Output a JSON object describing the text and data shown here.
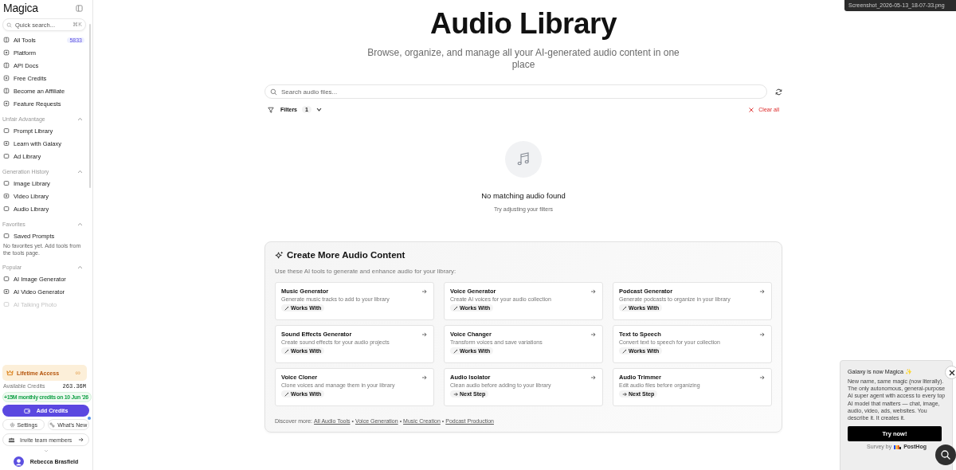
{
  "sidebar": {
    "logo": "Magica",
    "search": {
      "placeholder": "Quick search...",
      "shortcut": "⌘K"
    },
    "main_items": [
      {
        "label": "All Tools",
        "badge": "5833"
      },
      {
        "label": "Platform"
      },
      {
        "label": "API Docs"
      },
      {
        "label": "Free Credits"
      },
      {
        "label": "Become an Affiliate"
      },
      {
        "label": "Feature Requests"
      }
    ],
    "sections": [
      {
        "title": "Unfair Advantage",
        "expanded": true,
        "items": [
          {
            "label": "Prompt Library",
            "dimmed": false
          },
          {
            "label": "Learn with Galaxy",
            "dimmed": false
          },
          {
            "label": "Ad Library",
            "dimmed": false
          }
        ]
      },
      {
        "title": "Generation History",
        "expanded": true,
        "items": [
          {
            "label": "Image Library",
            "dimmed": false
          },
          {
            "label": "Video Library",
            "dimmed": false
          },
          {
            "label": "Audio Library",
            "dimmed": false
          }
        ]
      },
      {
        "title": "Favorites",
        "expanded": true,
        "items": [
          {
            "label": "Saved Prompts",
            "dimmed": false
          }
        ],
        "note": "No favorites yet. Add tools from the tools page."
      },
      {
        "title": "Popular",
        "expanded": true,
        "items": [
          {
            "label": "AI Image Generator",
            "dimmed": false
          },
          {
            "label": "AI Video Generator",
            "dimmed": false
          },
          {
            "label": "AI Talking Photo",
            "dimmed": true
          }
        ]
      }
    ],
    "plan": {
      "label": "Lifetime Access",
      "symbol": "∞"
    },
    "credits": {
      "label": "Available Credits",
      "value": "263.36M"
    },
    "monthly_note": "+15M monthly credits on 10 Jun '26",
    "add_credits": "Add Credits",
    "settings": "Settings",
    "whats_new": {
      "label": "What's New",
      "unread": true
    },
    "invite": "Invite team members",
    "user": {
      "name": "Rebecca Brasfield"
    }
  },
  "file_tooltip": "Screenshot_2026-05-13_18-07-33.png",
  "header": {
    "title": "Audio Library",
    "subtitle": "Browse, organize, and manage all your AI-generated audio content in one place"
  },
  "search": {
    "placeholder": "Search audio files..."
  },
  "filters": {
    "label": "Filters",
    "count": "1",
    "clear": "Clear all"
  },
  "empty_state": {
    "title": "No matching audio found",
    "hint": "Try adjusting your filters"
  },
  "create_more": {
    "title": "Create More Audio Content",
    "intro": "Use these AI tools to generate and enhance audio for your library:",
    "tools": [
      {
        "name": "Music Generator",
        "description": "Generate music tracks to add to your library",
        "tag": "Works With",
        "kind": "works"
      },
      {
        "name": "Voice Generator",
        "description": "Create AI voices for your audio collection",
        "tag": "Works With",
        "kind": "works"
      },
      {
        "name": "Podcast Generator",
        "description": "Generate podcasts to organize in your library",
        "tag": "Works With",
        "kind": "works"
      },
      {
        "name": "Sound Effects Generator",
        "description": "Create sound effects for your audio projects",
        "tag": "Works With",
        "kind": "works"
      },
      {
        "name": "Voice Changer",
        "description": "Transform voices and save variations",
        "tag": "Works With",
        "kind": "works"
      },
      {
        "name": "Text to Speech",
        "description": "Convert text to speech for your collection",
        "tag": "Works With",
        "kind": "works"
      },
      {
        "name": "Voice Cloner",
        "description": "Clone voices and manage them in your library",
        "tag": "Works With",
        "kind": "works"
      },
      {
        "name": "Audio Isolator",
        "description": "Clean audio before adding to your library",
        "tag": "Next Step",
        "kind": "next"
      },
      {
        "name": "Audio Trimmer",
        "description": "Edit audio files before organizing",
        "tag": "Next Step",
        "kind": "next"
      }
    ],
    "discover_label": "Discover more:",
    "links": [
      "All Audio Tools",
      "Voice Generation",
      "Music Creation",
      "Podcast Production"
    ],
    "separator": "•"
  },
  "survey": {
    "title": "Galaxy is now Magica ✨",
    "body": "New name, same magic (now literally). The only autonomous, general-purpose AI super agent with access to every top AI model that matters — chat, image, audio, video, ads, websites. You describe it. It creates it.",
    "button": "Try now!",
    "footer_prefix": "Survey by",
    "footer_brand": "PostHog"
  }
}
